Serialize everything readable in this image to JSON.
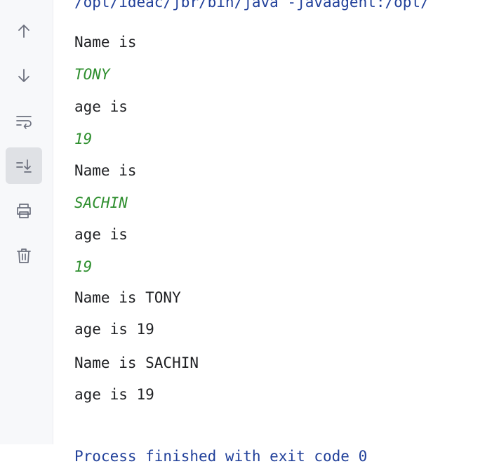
{
  "toolbar": {
    "items": [
      {
        "icon": "arrow-up-icon",
        "active": false
      },
      {
        "icon": "arrow-down-icon",
        "active": false
      },
      {
        "icon": "soft-wrap-icon",
        "active": false
      },
      {
        "icon": "scroll-to-end-icon",
        "active": true
      },
      {
        "icon": "print-icon",
        "active": false
      },
      {
        "icon": "trash-icon",
        "active": false
      }
    ]
  },
  "console": {
    "command_line": "/opt/ideac/jbr/bin/java -javaagent:/opt/",
    "lines": [
      {
        "text": "Name is",
        "kind": "stdout"
      },
      {
        "text": "TONY",
        "kind": "input"
      },
      {
        "text": "age is",
        "kind": "stdout"
      },
      {
        "text": "19",
        "kind": "input"
      },
      {
        "text": "Name is",
        "kind": "stdout"
      },
      {
        "text": "SACHIN",
        "kind": "input"
      },
      {
        "text": "age is",
        "kind": "stdout"
      },
      {
        "text": "19",
        "kind": "input"
      },
      {
        "text": "Name is TONY",
        "kind": "stdout"
      },
      {
        "text": "age is 19",
        "kind": "stdout"
      },
      {
        "text": "Name is SACHIN",
        "kind": "stdout"
      },
      {
        "text": "age is 19",
        "kind": "stdout"
      }
    ],
    "exit_message": "Process finished with exit code 0"
  }
}
